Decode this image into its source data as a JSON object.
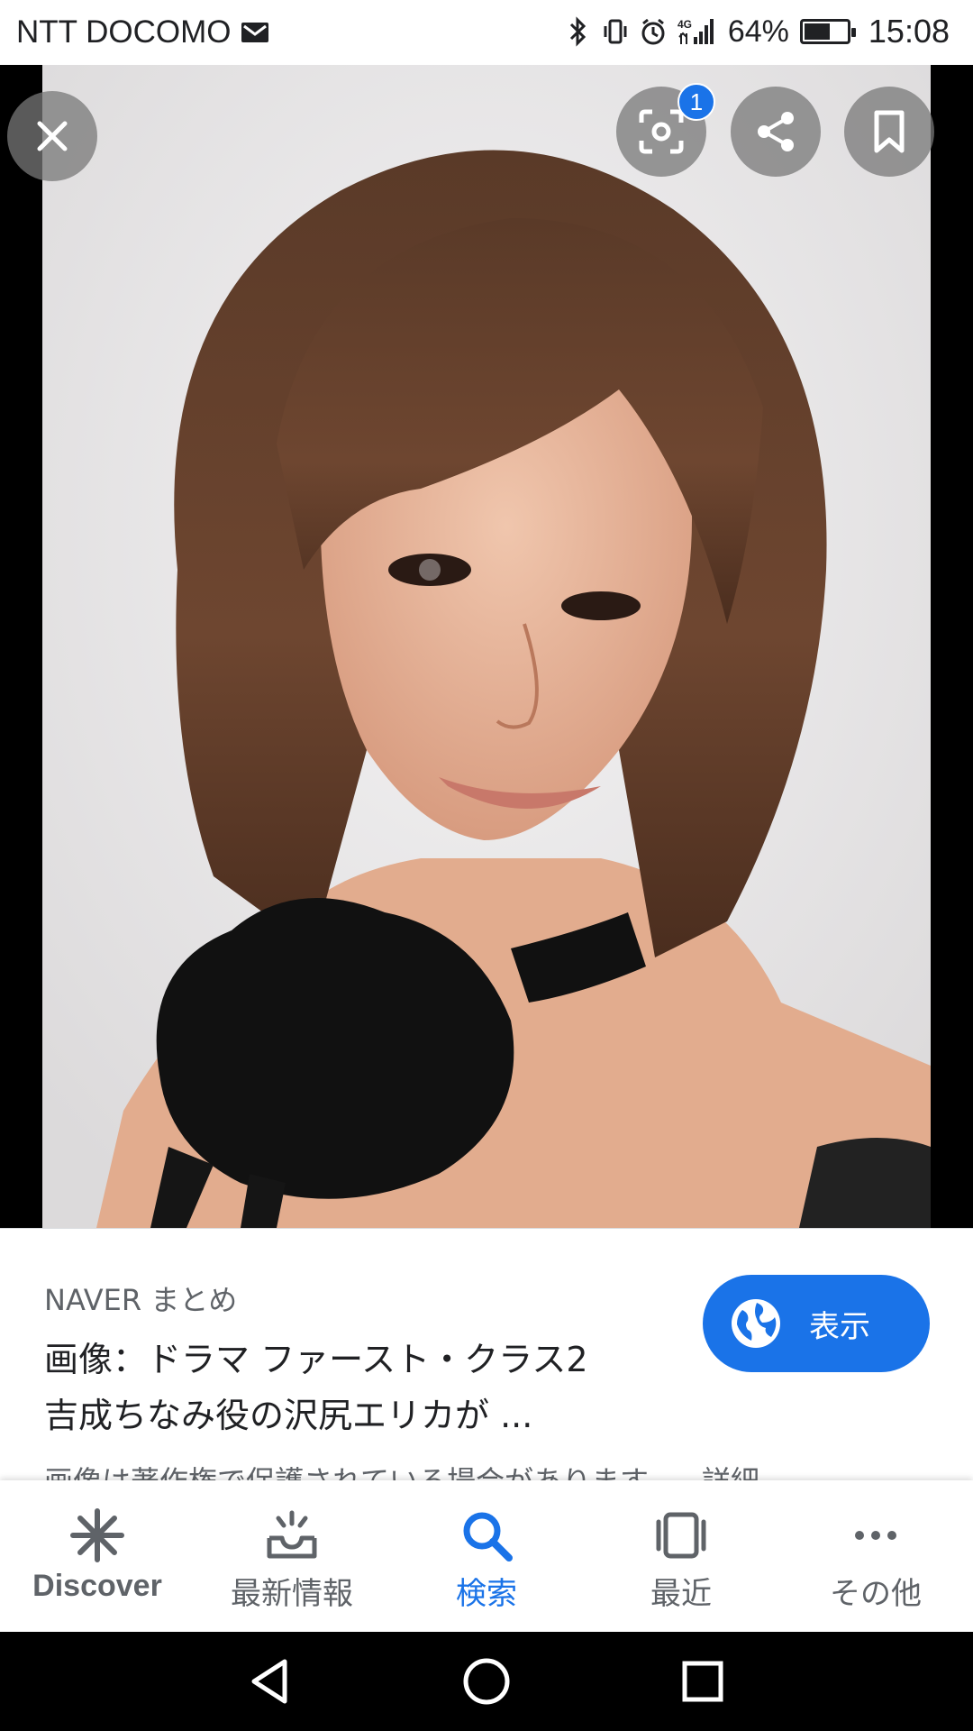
{
  "status_bar": {
    "carrier": "NTT DOCOMO",
    "battery_percent": "64%",
    "battery_level": 0.64,
    "time": "15:08",
    "icons": [
      "mail-icon",
      "bluetooth-icon",
      "vibrate-icon",
      "alarm-icon",
      "4g-signal-icon",
      "battery-icon"
    ]
  },
  "viewer": {
    "close_icon": "close-icon",
    "lens_badge": "1",
    "actions": [
      "lens-icon",
      "share-icon",
      "bookmark-icon"
    ]
  },
  "result": {
    "source": "NAVER まとめ",
    "title_line1": "画像：ドラマ ファースト・クラス2",
    "title_line2": "吉成ちなみ役の沢尻エリカが ...",
    "visit_label": "表示",
    "copyright": "画像は著作権で保護されている場合があります。",
    "details": "詳細"
  },
  "bottom_nav": {
    "items": [
      {
        "label": "Discover",
        "icon": "discover-asterisk-icon"
      },
      {
        "label": "最新情報",
        "icon": "updates-inbox-icon"
      },
      {
        "label": "検索",
        "icon": "search-icon"
      },
      {
        "label": "最近",
        "icon": "recents-icon"
      },
      {
        "label": "その他",
        "icon": "more-dots-icon"
      }
    ],
    "active_index": 2
  },
  "colors": {
    "accent": "#1a73e8",
    "text_primary": "#202124",
    "text_secondary": "#5f6368"
  }
}
